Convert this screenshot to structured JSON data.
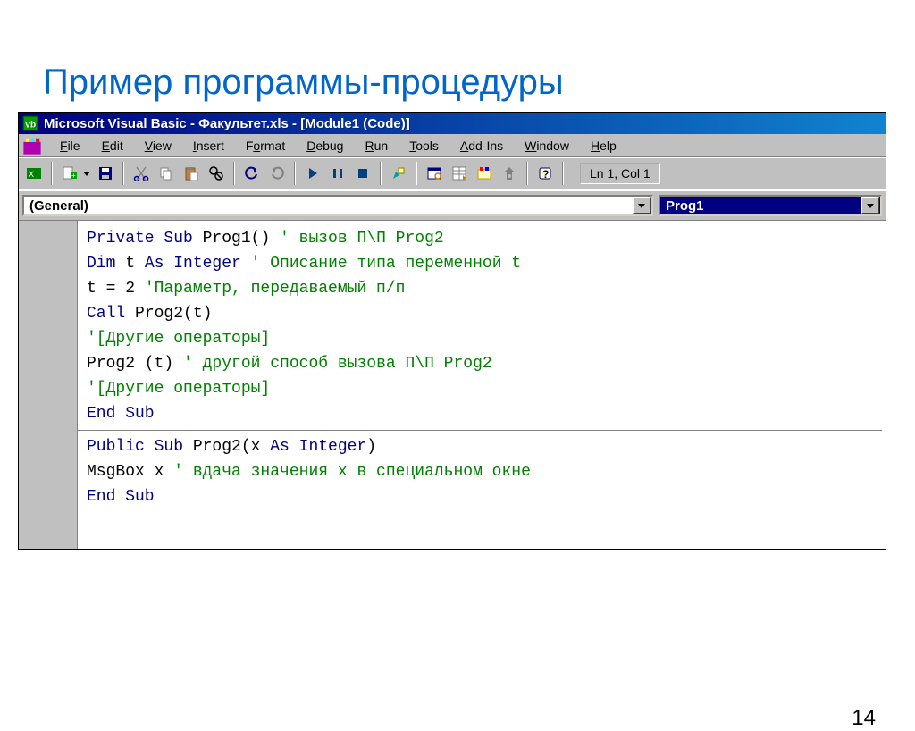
{
  "heading": "Пример программы-процедуры",
  "titlebar": "Microsoft Visual Basic - Факультет.xls - [Module1 (Code)]",
  "menu": {
    "file": "File",
    "edit": "Edit",
    "view": "View",
    "insert": "Insert",
    "format": "Format",
    "debug": "Debug",
    "run": "Run",
    "tools": "Tools",
    "addins": "Add-Ins",
    "window": "Window",
    "help": "Help"
  },
  "toolbar": {
    "position": "Ln 1, Col 1"
  },
  "combos": {
    "object": "(General)",
    "proc": "Prog1"
  },
  "code": {
    "l1a": "Private Sub",
    "l1b": " Prog1() ",
    "l1c": "' вызов П\\П Prog2",
    "l2a": "Dim",
    "l2b": " t ",
    "l2c": "As Integer",
    "l2d": " ",
    "l2e": "' Описание типа переменной t",
    "l3a": "t = 2 ",
    "l3b": "'Параметр, передаваемый п/п",
    "l4a": "Call",
    "l4b": " Prog2(t)",
    "l5": "'[Другие операторы]",
    "l6a": "Prog2 (t) ",
    "l6b": "' другой способ вызова П\\П Prog2",
    "l7": "'[Другие операторы]",
    "l8": "End Sub",
    "l9a": "Public Sub",
    "l9b": " Prog2(x ",
    "l9c": "As Integer",
    "l9d": ")",
    "l10a": "MsgBox x ",
    "l10b": "' вдача значения x в специальном окне",
    "l11": "End Sub"
  },
  "page_number": "14"
}
